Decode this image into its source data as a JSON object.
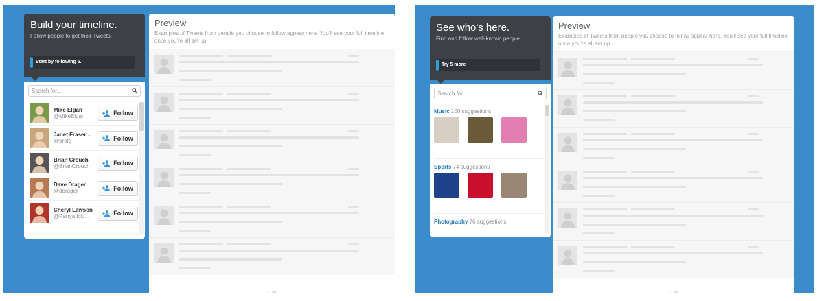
{
  "left": {
    "onboarding": {
      "title": "Build your timeline.",
      "subtitle": "Follow people to get their Tweets.",
      "step_label": "Start by following 5."
    },
    "search": {
      "placeholder": "Search for..."
    },
    "follow_label": "Follow",
    "users": [
      {
        "name": "Mike Elgan",
        "handle": "@MikeElgan",
        "avatar_color": "#7a9a4a"
      },
      {
        "name": "Janet Fraser...",
        "handle": "@broftj",
        "avatar_color": "#c9a57d"
      },
      {
        "name": "Brian Crouch",
        "handle": "@BrianCrouch",
        "avatar_color": "#555555"
      },
      {
        "name": "Dave Drager",
        "handle": "@ddrager",
        "avatar_color": "#b87a55"
      },
      {
        "name": "Cheryl Lawson",
        "handle": "@Partyaficio...",
        "avatar_color": "#b0342a"
      }
    ],
    "preview": {
      "title": "Preview",
      "description": "Examples of Tweets from people you choose to follow appear here. You'll see your full timeline once you're all set up."
    }
  },
  "right": {
    "onboarding": {
      "title": "See who's here.",
      "subtitle": "Find and follow well-known people.",
      "step_label": "Try 5 more"
    },
    "search": {
      "placeholder": "Search for..."
    },
    "categories": [
      {
        "name": "Music",
        "count": "100 suggestions",
        "thumb_colors": [
          "#d8cfc4",
          "#6b5a3a",
          "#e07fb0"
        ]
      },
      {
        "name": "Sports",
        "count": "74 suggestions",
        "thumb_colors": [
          "#1d428a",
          "#c8102e",
          "#9a8675"
        ]
      },
      {
        "name": "Photography",
        "count": "76 suggestions",
        "thumb_colors": []
      }
    ],
    "preview": {
      "title": "Preview",
      "description": "Examples of Tweets from people you choose to follow appear here. You'll see your full timeline once you're all set up."
    }
  },
  "colors": {
    "background": "#3b8ccb",
    "dark_panel": "#3d4146",
    "accent": "#2f9fe3",
    "link": "#2b7bb9"
  }
}
